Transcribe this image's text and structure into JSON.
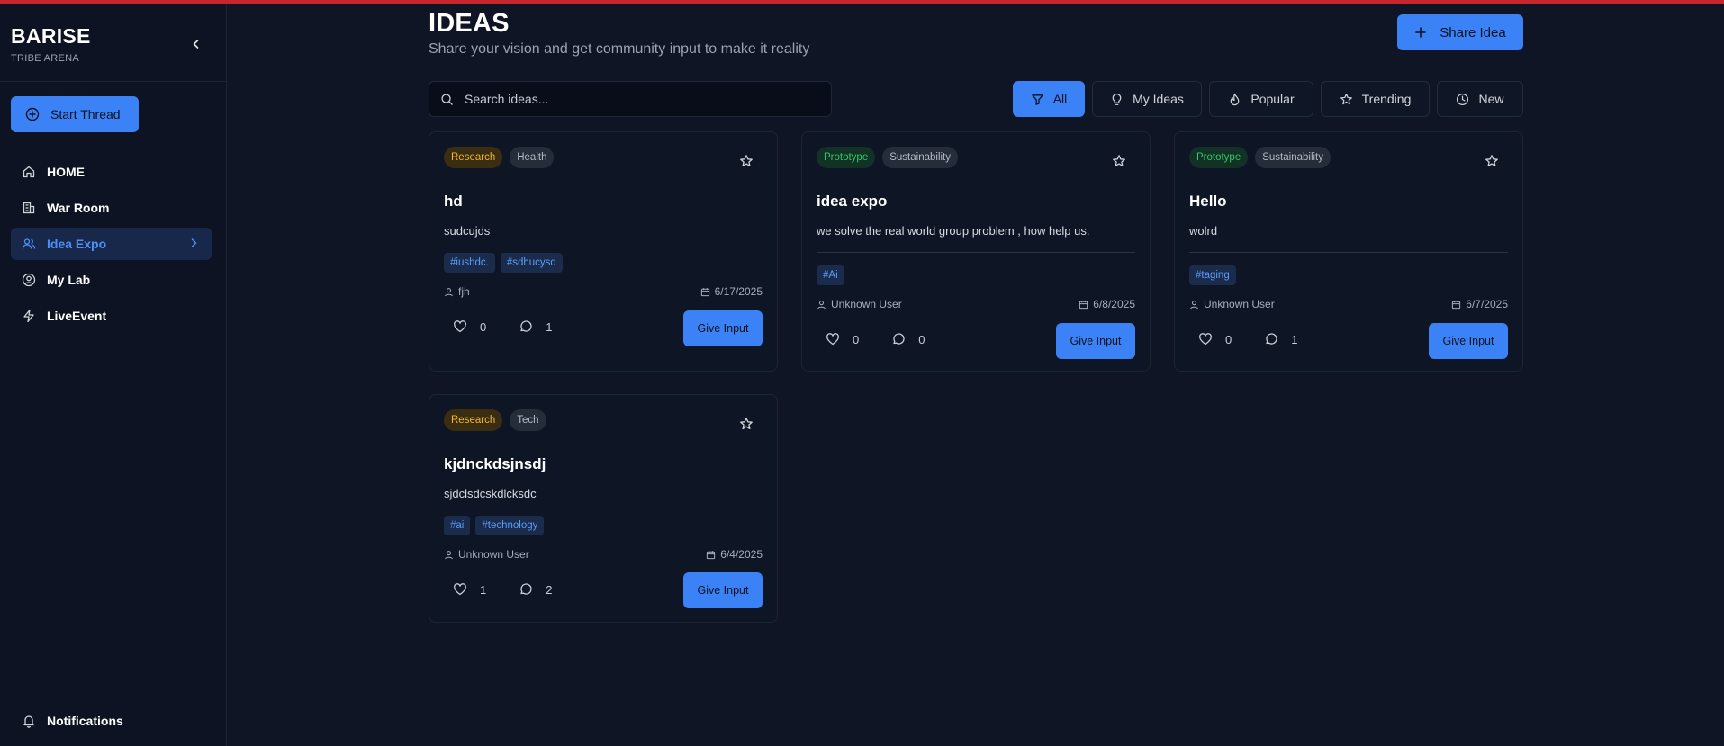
{
  "brand": {
    "name": "BARISE",
    "subtitle": "TRIBE ARENA"
  },
  "sidebar": {
    "start_thread_label": "Start Thread",
    "items": [
      {
        "label": "HOME",
        "icon": "home-icon"
      },
      {
        "label": "War Room",
        "icon": "building-icon"
      },
      {
        "label": "Idea Expo",
        "icon": "users-icon",
        "active": true
      },
      {
        "label": "My Lab",
        "icon": "user-circle-icon"
      },
      {
        "label": "LiveEvent",
        "icon": "lightning-icon"
      }
    ],
    "notifications_label": "Notifications"
  },
  "header": {
    "title": "IDEAS",
    "subtitle": "Share your vision and get community input to make it reality",
    "share_label": "Share Idea"
  },
  "search": {
    "placeholder": "Search ideas...",
    "value": ""
  },
  "filters": [
    {
      "label": "All",
      "icon": "filter-icon",
      "active": true
    },
    {
      "label": "My Ideas",
      "icon": "lightbulb-icon"
    },
    {
      "label": "Popular",
      "icon": "flame-icon"
    },
    {
      "label": "Trending",
      "icon": "star-icon"
    },
    {
      "label": "New",
      "icon": "clock-icon"
    }
  ],
  "ideas": [
    {
      "stage": "Research",
      "category": "Health",
      "title": "hd",
      "description": "sudcujds",
      "hashtags": [
        "#iushdc.",
        "#sdhucysd"
      ],
      "author": "fjh",
      "date": "6/17/2025",
      "likes": "0",
      "comments": "1",
      "action_label": "Give Input"
    },
    {
      "stage": "Prototype",
      "category": "Sustainability",
      "title": "idea expo",
      "description": "we solve the real world group problem , how help us.",
      "hashtags": [
        "#Ai"
      ],
      "author": "Unknown User",
      "date": "6/8/2025",
      "likes": "0",
      "comments": "0",
      "action_label": "Give Input"
    },
    {
      "stage": "Prototype",
      "category": "Sustainability",
      "title": "Hello",
      "description": "wolrd",
      "hashtags": [
        "#taging"
      ],
      "author": "Unknown User",
      "date": "6/7/2025",
      "likes": "0",
      "comments": "1",
      "action_label": "Give Input"
    },
    {
      "stage": "Research",
      "category": "Tech",
      "title": "kjdnckdsjnsdj",
      "description": "sjdclsdcskdlcksdc",
      "hashtags": [
        "#ai",
        "#technology"
      ],
      "author": "Unknown User",
      "date": "6/4/2025",
      "likes": "1",
      "comments": "2",
      "action_label": "Give Input"
    }
  ],
  "colors": {
    "accent": "#3b82f6",
    "background": "#0f1524",
    "research": "#f2b82c",
    "prototype": "#35c46d",
    "topbar": "#c8262d"
  }
}
